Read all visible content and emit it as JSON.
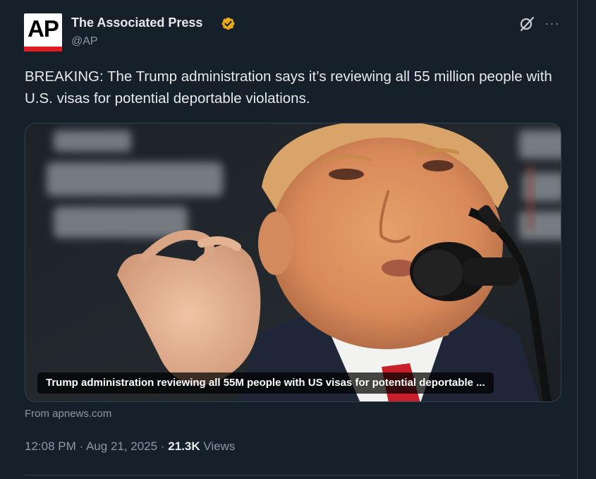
{
  "author": {
    "display_name": "The Associated Press",
    "handle": "@AP",
    "avatar_text": "AP",
    "verified_color": "#e8a917"
  },
  "tweet": {
    "text": "BREAKING: The Trump administration says it’s reviewing all 55 million people with U.S. visas for potential deportable violations."
  },
  "card": {
    "caption": "Trump administration reviewing all 55M people with US visas for potential deportable ...",
    "source": "From apnews.com"
  },
  "meta": {
    "time": "12:08 PM",
    "date": "Aug 21, 2025",
    "separator": "·",
    "views_count": "21.3K",
    "views_label": "Views"
  },
  "icons": {
    "verified": "verified-badge-icon",
    "grok": "grok-icon",
    "more": "more-icon"
  },
  "colors": {
    "background": "#15202b",
    "text": "#e7e9ea",
    "secondary_text": "#8b98a5",
    "border": "#38444d",
    "ap_red": "#e31b23"
  }
}
